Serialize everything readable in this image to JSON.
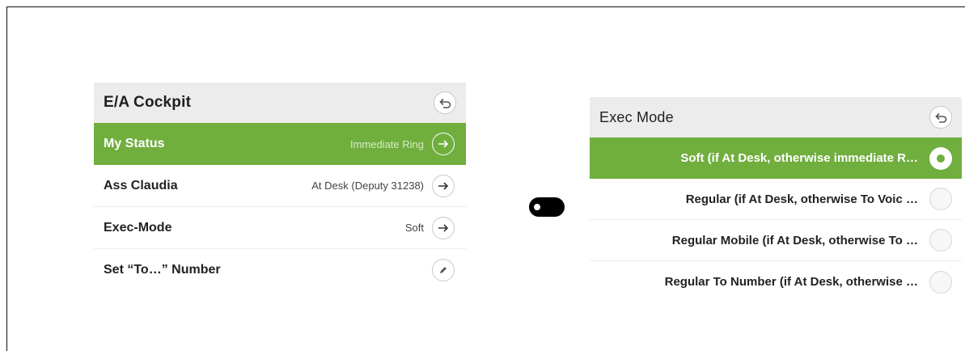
{
  "left_panel": {
    "title": "E/A Cockpit",
    "rows": [
      {
        "label": "My Status",
        "value": "Immediate Ring",
        "active": true
      },
      {
        "label": "Ass Claudia",
        "value": "At Desk (Deputy 31238)",
        "active": false
      },
      {
        "label": "Exec-Mode",
        "value": "Soft",
        "active": false
      },
      {
        "label": "Set “To…” Number",
        "value": "",
        "active": false
      }
    ]
  },
  "right_panel": {
    "title": "Exec Mode",
    "options": [
      {
        "label": "Soft (if At Desk, otherwise immediate R…",
        "selected": true
      },
      {
        "label": "Regular (if At Desk, otherwise To Voic …",
        "selected": false
      },
      {
        "label": "Regular Mobile (if At Desk, otherwise To …",
        "selected": false
      },
      {
        "label": "Regular To Number (if At Desk, otherwise …",
        "selected": false
      }
    ]
  },
  "colors": {
    "accent": "#70ae3e",
    "header_bg": "#ececec",
    "toggle": "#000000"
  },
  "icons": {
    "back": "back-arrow-icon",
    "forward": "arrow-right-icon",
    "edit": "pencil-icon"
  }
}
